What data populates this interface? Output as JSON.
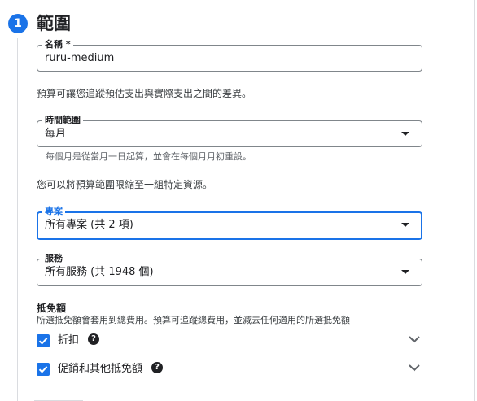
{
  "step": {
    "number": "1",
    "title": "範圍"
  },
  "name_field": {
    "label": "名稱 *",
    "value": "ruru-medium"
  },
  "budget_desc": "預算可讓您追蹤預估支出與實際支出之間的差異。",
  "time_range": {
    "label": "時間範圍",
    "value": "每月",
    "hint": "每個月是從當月一日起算，並會在每個月月初重設。"
  },
  "scope_desc": "您可以將預算範圍限縮至一組特定資源。",
  "projects": {
    "label": "專案",
    "value": "所有專案 (共 2 項)"
  },
  "services": {
    "label": "服務",
    "value": "所有服務 (共 1948 個)"
  },
  "credits": {
    "heading": "抵免額",
    "description": "所選抵免額會套用到總費用。預算可追蹤總費用，並減去任何適用的所選抵免額",
    "items": [
      {
        "label": "折扣",
        "checked": true
      },
      {
        "label": "促銷和其他抵免額",
        "checked": true
      }
    ]
  },
  "colors": {
    "accent": "#1a73e8",
    "text": "#202124",
    "border": "#80868b"
  }
}
